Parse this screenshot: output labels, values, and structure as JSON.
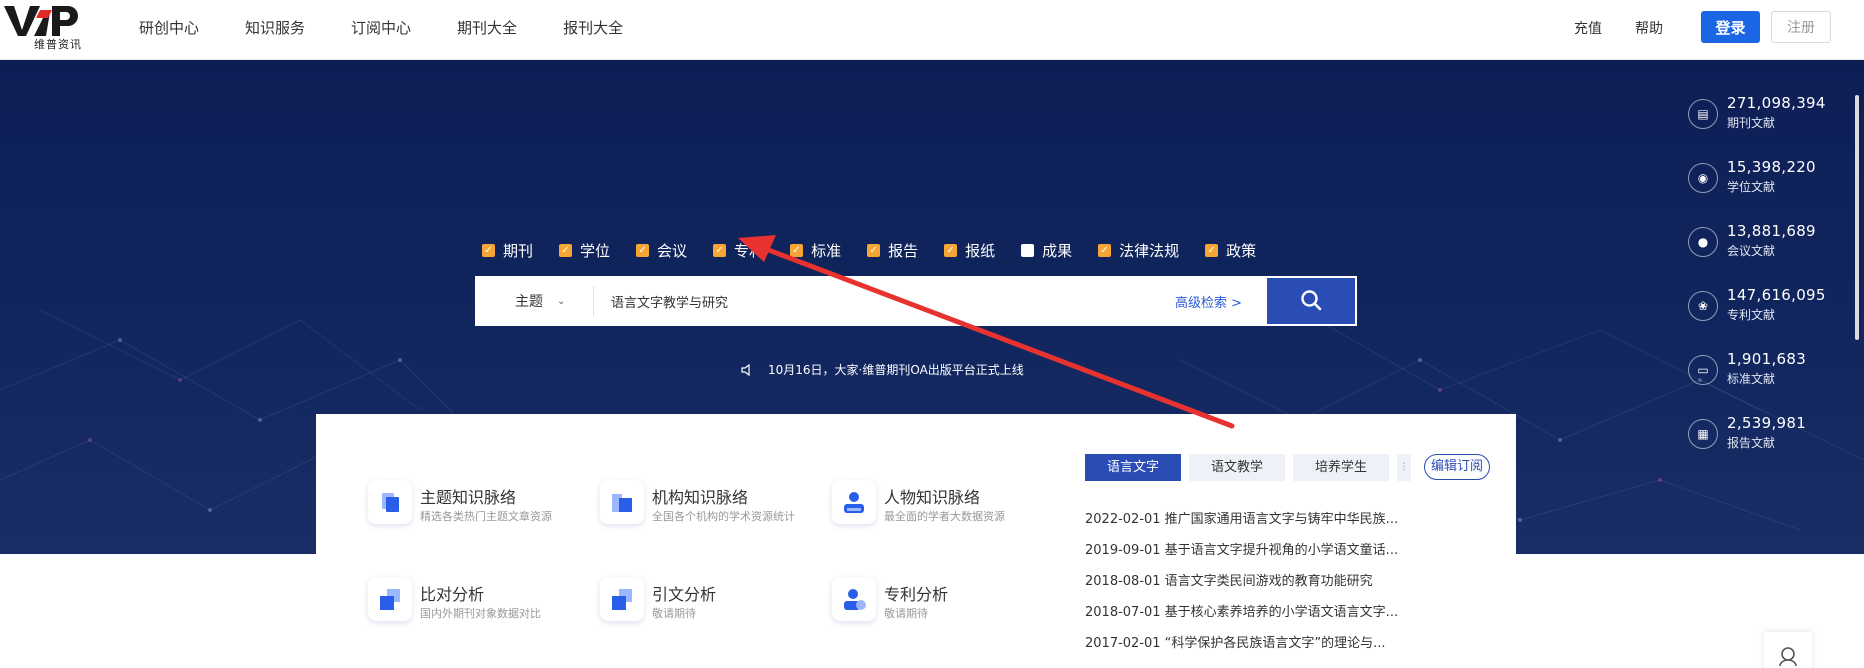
{
  "header": {
    "logo_text": "VIP",
    "logo_subtitle": "维普资讯",
    "nav": [
      "研创中心",
      "知识服务",
      "订阅中心",
      "期刊大全",
      "报刊大全"
    ],
    "recharge": "充值",
    "help": "帮助",
    "login": "登录",
    "register": "注册"
  },
  "search": {
    "types": [
      {
        "label": "期刊",
        "checked": true
      },
      {
        "label": "学位",
        "checked": true
      },
      {
        "label": "会议",
        "checked": true
      },
      {
        "label": "专利",
        "checked": true
      },
      {
        "label": "标准",
        "checked": true
      },
      {
        "label": "报告",
        "checked": true
      },
      {
        "label": "报纸",
        "checked": true
      },
      {
        "label": "成果",
        "checked": false
      },
      {
        "label": "法律法规",
        "checked": true
      },
      {
        "label": "政策",
        "checked": true
      }
    ],
    "field": "主题",
    "query": "语言文字教学与研究",
    "advanced": "高级检索 >",
    "notice": "10月16日，大家·维普期刊OA出版平台正式上线"
  },
  "stats": [
    {
      "icon": "journal-icon",
      "value": "271,098,394",
      "label": "期刊文献"
    },
    {
      "icon": "degree-icon",
      "value": "15,398,220",
      "label": "学位文献"
    },
    {
      "icon": "conference-icon",
      "value": "13,881,689",
      "label": "会议文献"
    },
    {
      "icon": "patent-icon",
      "value": "147,616,095",
      "label": "专利文献"
    },
    {
      "icon": "standard-icon",
      "value": "1,901,683",
      "label": "标准文献"
    },
    {
      "icon": "report-icon",
      "value": "2,539,981",
      "label": "报告文献"
    }
  ],
  "features": [
    {
      "title": "主题知识脉络",
      "sub": "精选各类热门主题文章资源"
    },
    {
      "title": "机构知识脉络",
      "sub": "全国各个机构的学术资源统计"
    },
    {
      "title": "人物知识脉络",
      "sub": "最全面的学者大数据资源"
    },
    {
      "title": "比对分析",
      "sub": "国内外期刊对象数据对比"
    },
    {
      "title": "引文分析",
      "sub": "敬请期待"
    },
    {
      "title": "专利分析",
      "sub": "敬请期待"
    }
  ],
  "subscription": {
    "tabs": [
      "语言文字",
      "语文教学",
      "培养学生"
    ],
    "edit": "编辑订阅",
    "items": [
      "2022-02-01  推广国家通用语言文字与铸牢中华民族...",
      "2019-09-01  基于语言文字提升视角的小学语文童话...",
      "2018-08-01  语言文字类民间游戏的教育功能研究",
      "2018-07-01  基于核心素养培养的小学语文语言文字...",
      "2017-02-01  “科学保护各民族语言文字”的理论与..."
    ]
  },
  "colors": {
    "accent": "#2a4cb5",
    "login_button": "#1a66e5",
    "checkbox": "#f7a633",
    "hero_bg": "#0d1e55",
    "annotation_arrow": "#e8322f"
  }
}
